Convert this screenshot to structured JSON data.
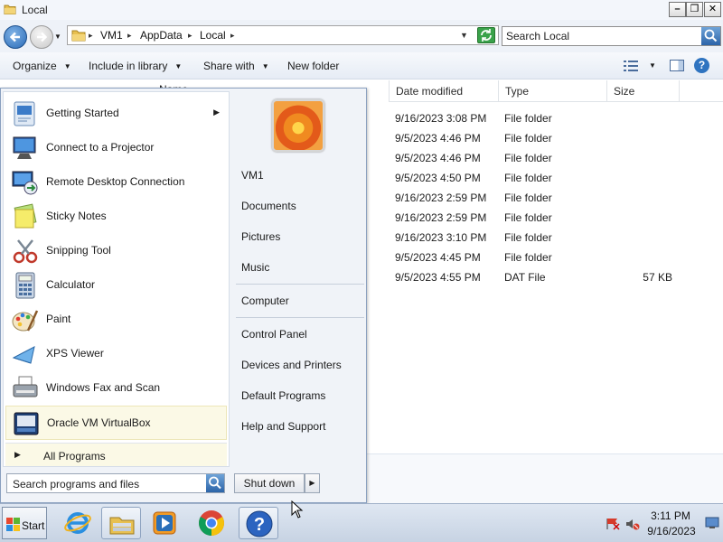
{
  "window": {
    "title": "Local"
  },
  "address": {
    "crumbs": [
      "VM1",
      "AppData",
      "Local"
    ]
  },
  "search": {
    "placeholder": "Search Local"
  },
  "toolbar": {
    "organize": "Organize",
    "include": "Include in library",
    "share": "Share with",
    "new_folder": "New folder"
  },
  "columns": {
    "name": "Name",
    "date": "Date modified",
    "type": "Type",
    "size": "Size"
  },
  "files": [
    {
      "date": "9/16/2023 3:08 PM",
      "type": "File folder",
      "size": ""
    },
    {
      "date": "9/5/2023 4:46 PM",
      "type": "File folder",
      "size": ""
    },
    {
      "date": "9/5/2023 4:46 PM",
      "type": "File folder",
      "size": ""
    },
    {
      "date": "9/5/2023 4:50 PM",
      "type": "File folder",
      "size": ""
    },
    {
      "date": "9/16/2023 2:59 PM",
      "type": "File folder",
      "size": ""
    },
    {
      "date": "9/16/2023 2:59 PM",
      "type": "File folder",
      "size": ""
    },
    {
      "date": "9/16/2023 3:10 PM",
      "type": "File folder",
      "size": ""
    },
    {
      "date": "9/5/2023 4:45 PM",
      "type": "File folder",
      "size": ""
    },
    {
      "date": "9/5/2023 4:55 PM",
      "type": "DAT File",
      "size": "57 KB"
    }
  ],
  "start_menu": {
    "programs": [
      {
        "label": "Getting Started",
        "icon": "getting-started-icon"
      },
      {
        "label": "Connect to a Projector",
        "icon": "projector-icon"
      },
      {
        "label": "Remote Desktop Connection",
        "icon": "remote-desktop-icon"
      },
      {
        "label": "Sticky Notes",
        "icon": "sticky-notes-icon"
      },
      {
        "label": "Snipping Tool",
        "icon": "snipping-tool-icon"
      },
      {
        "label": "Calculator",
        "icon": "calculator-icon"
      },
      {
        "label": "Paint",
        "icon": "paint-icon"
      },
      {
        "label": "XPS Viewer",
        "icon": "xps-viewer-icon"
      },
      {
        "label": "Windows Fax and Scan",
        "icon": "fax-scan-icon"
      },
      {
        "label": "Oracle VM VirtualBox",
        "icon": "virtualbox-icon"
      }
    ],
    "all_programs": "All Programs",
    "search_placeholder": "Search programs and files",
    "places": {
      "user": "VM1",
      "documents": "Documents",
      "pictures": "Pictures",
      "music": "Music",
      "computer": "Computer",
      "control_panel": "Control Panel",
      "devices": "Devices and Printers",
      "defaults": "Default Programs",
      "help": "Help and Support"
    },
    "shutdown": "Shut down"
  },
  "taskbar": {
    "start": "Start",
    "pinned": [
      "internet-explorer-icon",
      "file-explorer-icon",
      "media-player-icon",
      "chrome-icon",
      "help-icon"
    ],
    "time": "3:11 PM",
    "date": "9/16/2023"
  },
  "colors": {
    "accent_blue": "#2c64a8",
    "highlight": "#fbf9e6",
    "taskbar": "#c7d3e3"
  }
}
